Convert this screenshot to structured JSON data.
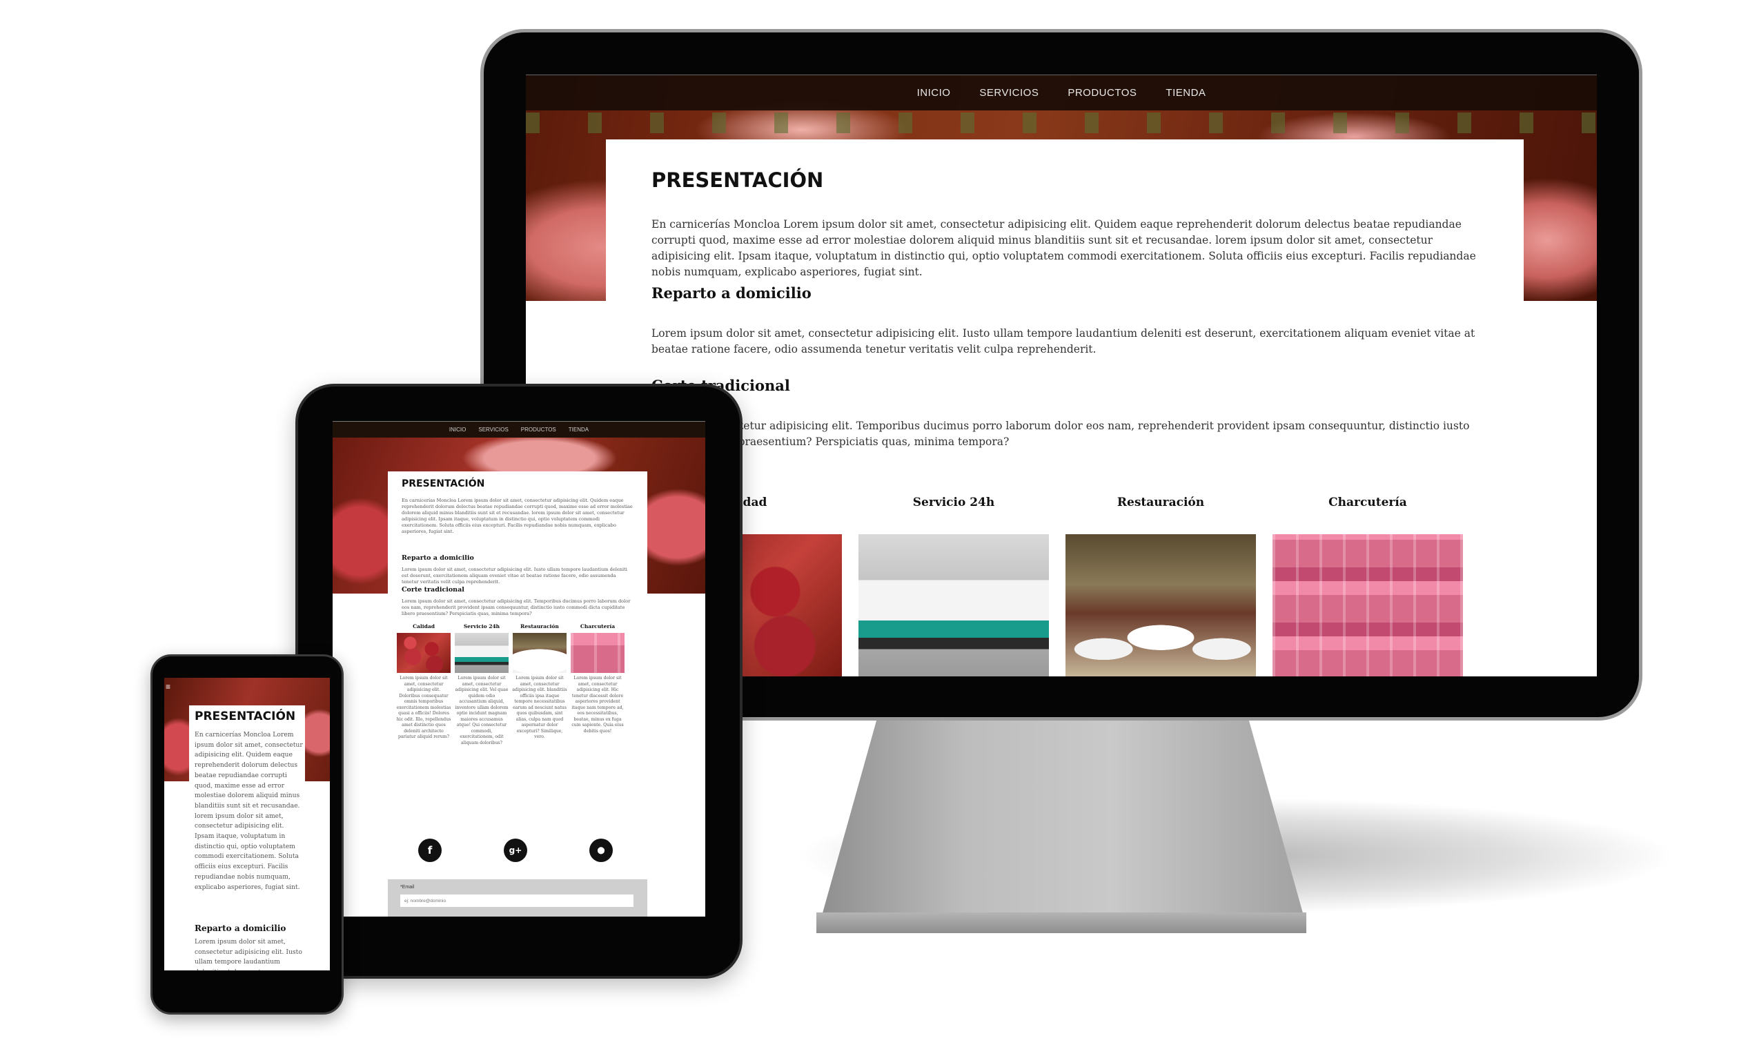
{
  "site": {
    "nav": [
      "INICIO",
      "SERVICIOS",
      "PRODUCTOS",
      "TIENDA"
    ],
    "title": "PRESENTACIÓN",
    "intro": "En carnicerías Moncloa Lorem ipsum dolor sit amet, consectetur adipisicing elit. Quidem eaque reprehenderit dolorum delectus beatae repudiandae corrupti quod, maxime esse ad error molestiae dolorem aliquid minus blanditiis sunt sit et recusandae. lorem ipsum dolor sit amet, consectetur adipisicing elit. Ipsam itaque, voluptatum in distinctio qui, optio voluptatem commodi exercitationem. Soluta officiis eius excepturi. Facilis repudiandae nobis numquam, explicabo asperiores, fugiat sint.",
    "reparto_title": "Reparto a domicilio",
    "reparto_text": "Lorem ipsum dolor sit amet, consectetur adipisicing elit. Iusto ullam tempore laudantium deleniti est deserunt, exercitationem aliquam eveniet vitae at beatae ratione facere, odio assumenda tenetur veritatis velit culpa reprehenderit.",
    "corte_title": "Corte tradicional",
    "corte_text_desktop": "sit amet, consectetur adipisicing elit. Temporibus ducimus porro laborum dolor eos nam, reprehenderit provident ipsam consequuntur, distinctio iusto obiditate libero praesentium? Perspiciatis quas, minima tempora?",
    "corte_text_tablet": "Lorem ipsum dolor sit amet, consectetur adipisicing elit. Temporibus ducimus porro laborum dolor eos nam, reprehenderit provident ipsam consequuntur, distinctio iusto commodi dicta cupiditate libero praesentium? Perspiciatis quas, minima tempora?",
    "services_desktop": [
      "alidad",
      "Servicio 24h",
      "Restauración",
      "Charcutería"
    ],
    "services_tablet": [
      "Calidad",
      "Servicio 24h",
      "Restauración",
      "Charcutería"
    ],
    "service_texts": [
      "Lorem ipsum dolor sit amet, consectetur adipisicing elit. Doloribus consequatur omnis temporibus exercitationem molestias quasi a officiis! Dolores hic odit. Illo, repellendus amet distinctio quos deleniti architecto pariatur aliquid rerum?",
      "Lorem ipsum dolor sit amet, consectetur adipisicing elit. Vel quae quidem odio accusantium aliquid, inventore ullam dolorem optio incidunt magnam maiores accusamus atque! Qui consectetur commodi, exercitationem, odit aliquam doloribus?",
      "Lorem ipsum dolor sit amet, consectetur adipisicing elit. blanditiis officiis ipsa itaque tempore necessitatibus earum ad nesciunt natus quos quibusdam, sint alias, culpa nam quod aspernatur dolor excepturi? Similique, vero.",
      "Lorem ipsum dolor sit amet, consectetur adipisicing elit. Hic tenetur discessit dolore asperiores provident itaque nam tempore ad, eos necessitatibus, beatae, minus ex fuga cum sapiente. Quia eius debitis quos!"
    ],
    "social": {
      "facebook": "f",
      "googleplus": "g+",
      "location": "⬤"
    },
    "form": {
      "label": "*Email",
      "placeholder": "ej: nombre@dominio"
    },
    "phone_intro": "En carnicerías Moncloa Lorem ipsum dolor sit amet, consectetur adipisicing elit. Quidem eaque reprehenderit dolorum delectus beatae repudiandae corrupti quod, maxime esse ad error molestiae dolorem aliquid minus blanditiis sunt sit et recusandae. lorem ipsum dolor sit amet, consectetur adipisicing elit. Ipsam itaque, voluptatum in distinctio qui, optio voluptatem commodi exercitationem. Soluta officiis eius excepturi. Facilis repudiandae nobis numquam, explicabo asperiores, fugiat sint.",
    "phone_reparto_text": "Lorem ipsum dolor sit amet, consectetur adipisicing elit. Iusto ullam tempore laudantium deleniti est deserunt, exercitationem aliquam eveniet vitae at beatae ratione facere.",
    "menu_icon": "≡"
  }
}
